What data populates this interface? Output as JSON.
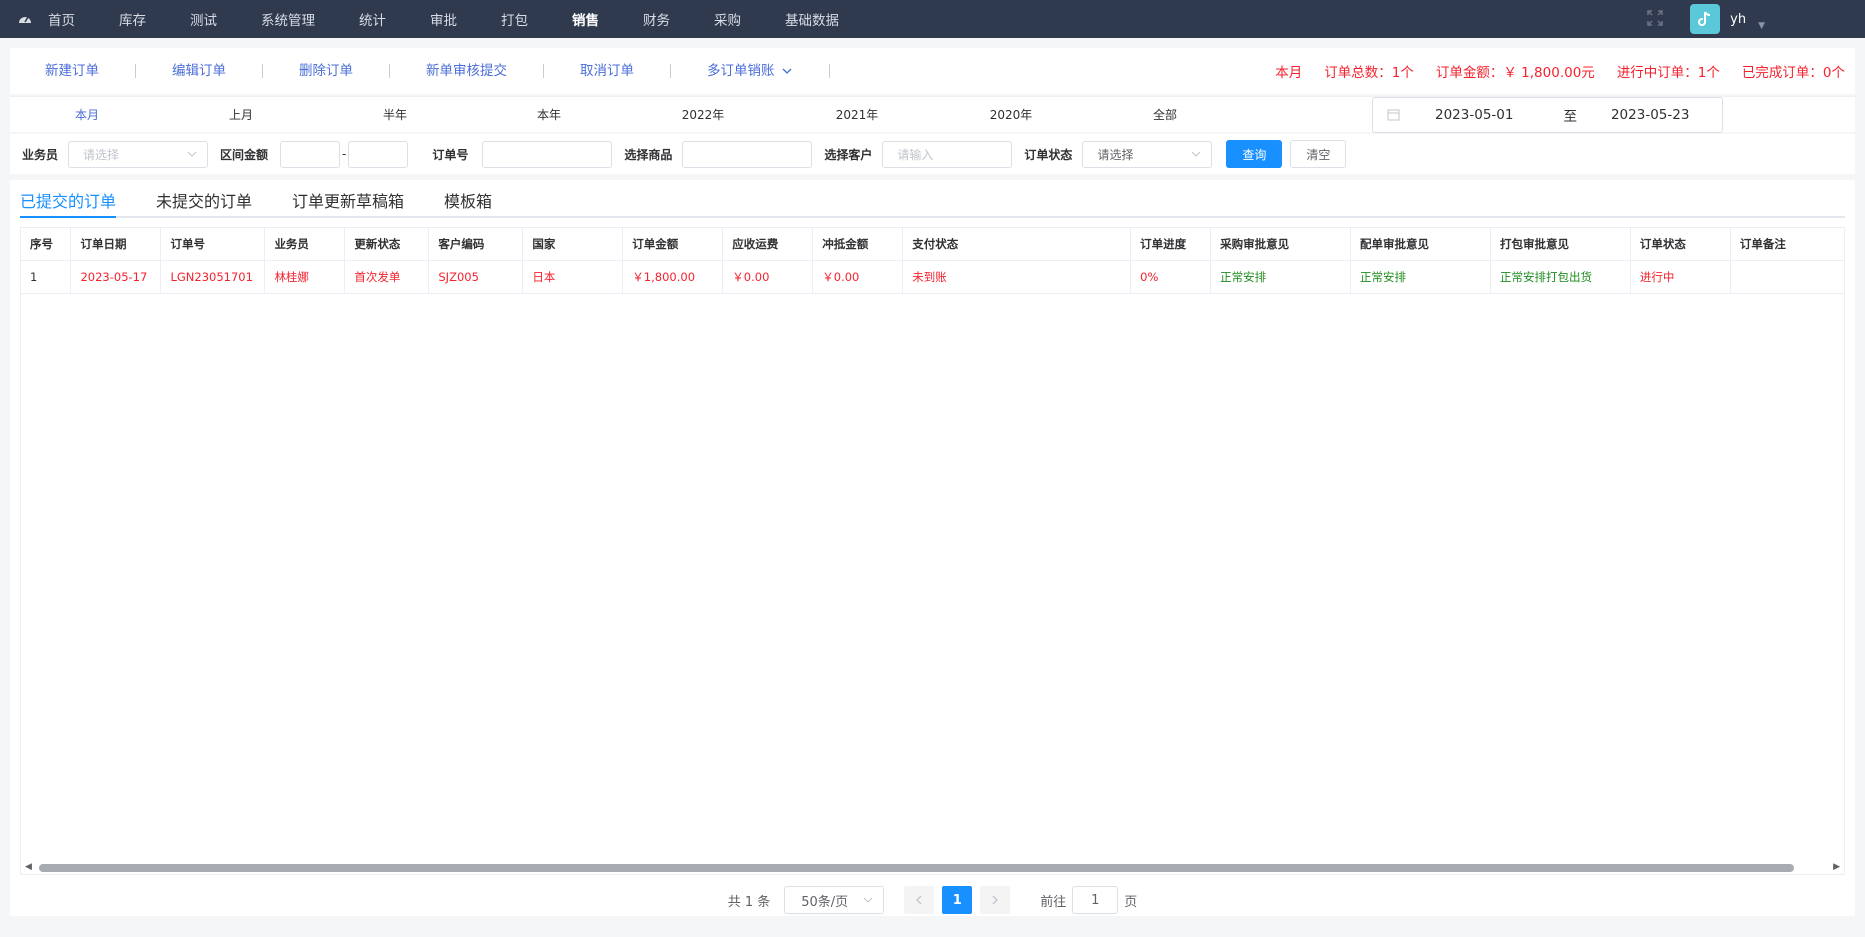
{
  "nav": {
    "items": [
      "首页",
      "库存",
      "测试",
      "系统管理",
      "统计",
      "审批",
      "打包",
      "销售",
      "财务",
      "采购",
      "基础数据"
    ],
    "active": "销售",
    "username": "yh"
  },
  "toolbar": {
    "buttons": [
      "新建订单",
      "编辑订单",
      "删除订单",
      "新单审核提交",
      "取消订单",
      "多订单销账"
    ],
    "stats": {
      "period": "本月",
      "total_orders": "订单总数：1个",
      "total_amount": "订单金额：￥ 1,800.00元",
      "in_progress": "进行中订单：1个",
      "completed": "已完成订单：0个"
    }
  },
  "ranges": {
    "items": [
      "本月",
      "上月",
      "半年",
      "本年",
      "2022年",
      "2021年",
      "2020年",
      "全部"
    ],
    "active": "本月",
    "date_start": "2023-05-01",
    "date_sep": "至",
    "date_end": "2023-05-23"
  },
  "filters": {
    "salesperson_label": "业务员",
    "salesperson_placeholder": "请选择",
    "amount_label": "区间金额",
    "amount_sep": "-",
    "order_no_label": "订单号",
    "product_label": "选择商品",
    "customer_label": "选择客户",
    "customer_placeholder": "请输入",
    "status_label": "订单状态",
    "status_value": "请选择",
    "query_button": "查询",
    "clear_button": "清空"
  },
  "tabs": [
    "已提交的订单",
    "未提交的订单",
    "订单更新草稿箱",
    "模板箱"
  ],
  "active_tab": "已提交的订单",
  "table": {
    "columns": [
      "序号",
      "订单日期",
      "订单号",
      "业务员",
      "更新状态",
      "客户编码",
      "国家",
      "订单金额",
      "应收运费",
      "冲抵金额",
      "支付状态",
      "订单进度",
      "采购审批意见",
      "配单审批意见",
      "打包审批意见",
      "订单状态",
      "订单备注"
    ],
    "rows": [
      [
        "1",
        "2023-05-17",
        "LGN23051701",
        "林桂娜",
        "首次发单",
        "SJZ005",
        "日本",
        "￥1,800.00",
        "￥0.00",
        "￥0.00",
        "未到账",
        "0%",
        "正常安排",
        "正常安排",
        "正常安排打包出货",
        "进行中",
        ""
      ]
    ]
  },
  "pager": {
    "total": "共 1 条",
    "page_size": "50条/页",
    "current": "1",
    "goto_label": "前往",
    "goto_value": "1",
    "page_suffix": "页"
  },
  "colors": {
    "nav_bg": "#2f3a4e",
    "accent": "#1890ff",
    "link": "#4a6ed8",
    "danger": "#f5222d",
    "success": "#1d8b1d"
  }
}
